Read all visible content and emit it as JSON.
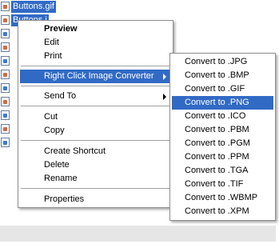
{
  "file_list": {
    "selected_name": "Buttons.gif",
    "partial_name": "Buttons.j"
  },
  "context_menu": {
    "items": [
      {
        "label": "Preview"
      },
      {
        "label": "Edit"
      },
      {
        "label": "Print"
      },
      {
        "label": "Right Click Image Converter"
      },
      {
        "label": "Send To"
      },
      {
        "label": "Cut"
      },
      {
        "label": "Copy"
      },
      {
        "label": "Create Shortcut"
      },
      {
        "label": "Delete"
      },
      {
        "label": "Rename"
      },
      {
        "label": "Properties"
      }
    ]
  },
  "submenu": {
    "items": [
      {
        "label": "Convert to .JPG"
      },
      {
        "label": "Convert to .BMP"
      },
      {
        "label": "Convert to .GIF"
      },
      {
        "label": "Convert to .PNG"
      },
      {
        "label": "Convert to .ICO"
      },
      {
        "label": "Convert to .PBM"
      },
      {
        "label": "Convert to .PGM"
      },
      {
        "label": "Convert to .PPM"
      },
      {
        "label": "Convert to .TGA"
      },
      {
        "label": "Convert to .TIF"
      },
      {
        "label": "Convert to .WBMP"
      },
      {
        "label": "Convert to .XPM"
      }
    ]
  },
  "colors": {
    "highlight": "#316ac5",
    "menu_border": "#8f8f8f",
    "background": "#ffffff"
  }
}
